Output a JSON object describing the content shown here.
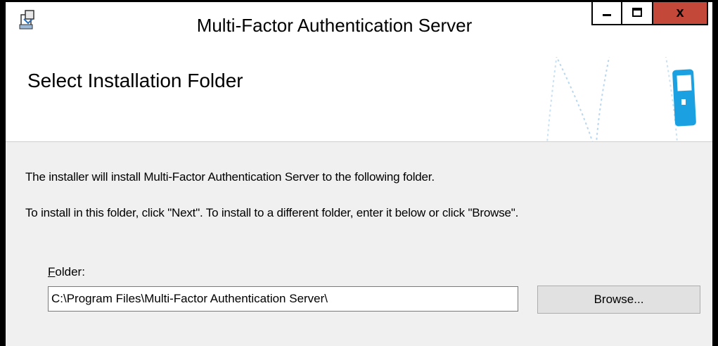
{
  "window": {
    "title": "Multi-Factor Authentication Server",
    "minimize_icon": "minimize-icon",
    "maximize_icon": "maximize-icon",
    "close_label": "x"
  },
  "header": {
    "title": "Select Installation Folder",
    "art_icon": "phone-lock-icon"
  },
  "body": {
    "line1": "The installer will install Multi-Factor Authentication Server to the following folder.",
    "line2": "To install in this folder, click \"Next\". To install to a different folder, enter it below or click \"Browse\".",
    "folder_label_accel": "F",
    "folder_label_rest": "older:",
    "folder_value": "C:\\Program Files\\Multi-Factor Authentication Server\\",
    "browse_label": "Browse..."
  },
  "colors": {
    "close_button": "#c4483a",
    "accent_blue": "#1ba1e2",
    "content_bg": "#f0f0f0"
  }
}
